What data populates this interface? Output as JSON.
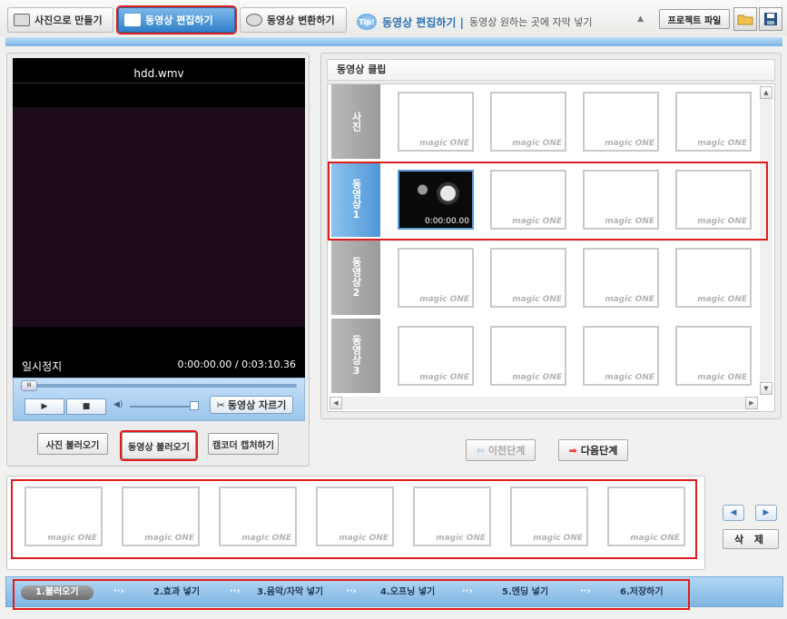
{
  "tabs": [
    {
      "label": "사진으로 만들기"
    },
    {
      "label": "동영상 편집하기"
    },
    {
      "label": "동영상 변환하기"
    }
  ],
  "tip": {
    "badge": "Tip!",
    "title": "동영상 편집하기 |",
    "text": "동영상 원하는 곳에 자막 넣기"
  },
  "project_file_label": "프로젝트 파일",
  "player": {
    "filename": "hdd.wmv",
    "state": "일시정지",
    "time": "0:00:00.00 / 0:03:10.36",
    "cut_label": "동영상 자르기"
  },
  "left_buttons": {
    "photo": "사진 불러오기",
    "video": "동영상 불러오기",
    "camcorder": "캠코더 캡처하기"
  },
  "clips": {
    "header": "동영상 클립",
    "rows": [
      "사진",
      "동영상1",
      "동영상2",
      "동영상3"
    ],
    "watermark": "magic ONE",
    "video_time": "0:00:00.00"
  },
  "nav": {
    "prev": "이전단계",
    "next": "다음단계"
  },
  "delete_label": "삭 제",
  "steps": [
    "1.불러오기",
    "2.효과 넣기",
    "3.음악/자막 넣기",
    "4.오프닝 넣기",
    "5.엔딩 넣기",
    "6.저장하기"
  ]
}
